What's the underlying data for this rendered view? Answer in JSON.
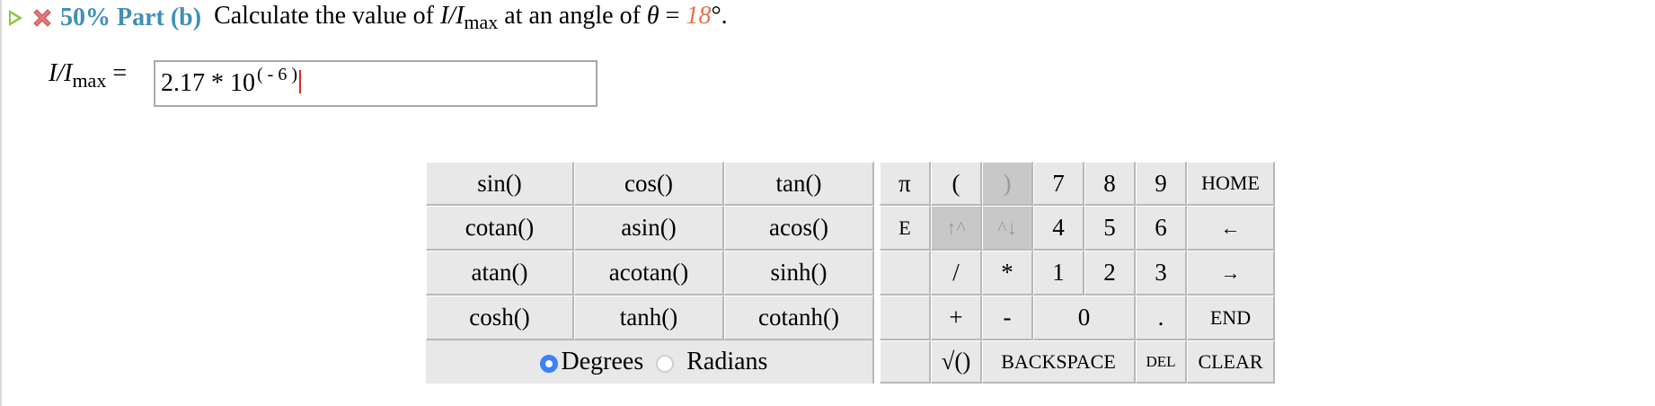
{
  "header": {
    "score": "50%",
    "part": "Part (b)",
    "question_pre": "Calculate the value of",
    "q_var": "I/I",
    "q_sub": "max",
    "question_mid": "at an angle of",
    "theta": "θ",
    "equals": "=",
    "angle_value": "18",
    "angle_unit": "°."
  },
  "answer": {
    "label_var": "I/I",
    "label_sub": "max",
    "label_eq": "=",
    "value_base": "2.17 * 10",
    "value_exp": "( - 6 )"
  },
  "keypad": {
    "functions": [
      [
        "sin()",
        "cos()",
        "tan()"
      ],
      [
        "cotan()",
        "asin()",
        "acos()"
      ],
      [
        "atan()",
        "acotan()",
        "sinh()"
      ],
      [
        "cosh()",
        "tanh()",
        "cotanh()"
      ]
    ],
    "pi": "π",
    "e": "E",
    "open_paren": "(",
    "close_paren": ")",
    "up_arrow": "↑^",
    "down_arrow": "^↓",
    "divide": "/",
    "multiply": "*",
    "plus": "+",
    "minus": "-",
    "sqrt": "√()",
    "digits": [
      "7",
      "8",
      "9",
      "4",
      "5",
      "6",
      "1",
      "2",
      "3",
      "0"
    ],
    "dot": ".",
    "home": "HOME",
    "left": "←",
    "right": "→",
    "end": "END",
    "backspace": "BACKSPACE",
    "del": "DEL",
    "clear": "CLEAR",
    "degrees": "Degrees",
    "radians": "Radians",
    "angle_mode": "Degrees"
  },
  "colors": {
    "score": "#3f8fb8",
    "angle_value": "#e8704a",
    "caret": "#e0281e",
    "radio_selected": "#3b82f6"
  }
}
